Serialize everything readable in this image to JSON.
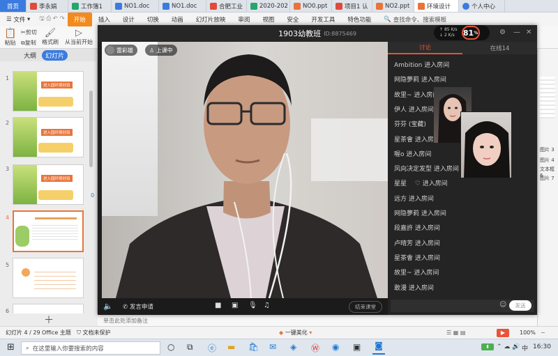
{
  "wps": {
    "tabs": [
      {
        "label": "首页",
        "color": "#3b7be0"
      },
      {
        "label": "李永娟",
        "color": "#e04a3b"
      },
      {
        "label": "工作簿1",
        "color": "#26a56c"
      },
      {
        "label": "NO1.doc",
        "color": "#3b7be0"
      },
      {
        "label": "NO1.doc",
        "color": "#3b7be0"
      },
      {
        "label": "合肥工业",
        "color": "#e04a3b"
      },
      {
        "label": "2020-202",
        "color": "#26a56c"
      },
      {
        "label": "NO0.ppt",
        "color": "#e8743a"
      },
      {
        "label": "项目1 认",
        "color": "#e04a3b"
      },
      {
        "label": "NO2.ppt",
        "color": "#e8743a"
      },
      {
        "label": "环境设计",
        "color": "#e8743a"
      },
      {
        "label": "个人中心",
        "color": "#3b7be0"
      }
    ],
    "file_menu": "文件",
    "menu": [
      "开始",
      "插入",
      "设计",
      "切换",
      "动画",
      "幻灯片放映",
      "审阅",
      "视图",
      "安全",
      "开发工具",
      "特色功能"
    ],
    "search_placeholder": "查找命令、搜索模板",
    "ribbon": {
      "cut": "剪切",
      "paste": "粘贴",
      "copy": "复制",
      "format_painter": "格式刷",
      "from_current": "从当前开始"
    },
    "panel_tabs": [
      "大纲",
      "幻灯片"
    ],
    "slide_numbers": [
      "1",
      "2",
      "3",
      "4",
      "5",
      "6"
    ],
    "slide_thumb_text": "进入园环境创设",
    "notes_placeholder": "单击此处添加备注",
    "status": {
      "slide_info": "幻灯片 4 / 29",
      "theme": "Office 主题",
      "protection": "文档未保护",
      "beautify": "一键美化",
      "zoom": "100%"
    },
    "right_strip": [
      "图片 3",
      "图片 4",
      "文本框 6",
      "图片 7"
    ],
    "right_zero": "0"
  },
  "classroom": {
    "title": "1903幼教班",
    "room_id": "ID:8875469",
    "net_up": "85 K/s",
    "net_down": "2 K/s",
    "cpu": "81",
    "cpu_unit": "%",
    "teacher_name": "雷彩雄",
    "teaching_badge": "上课中",
    "chat_tabs": [
      "讨论",
      "在线14"
    ],
    "messages": [
      "Ambition 进入房间",
      "网隐夢莉 进入房间",
      "故里~ 进入房间",
      "伊人 进入房间",
      "芬芬 (宝藏)",
      "星茶會 进入房间",
      "喔o 进入房间",
      "风向决定发型 进入房间",
      "星星　  ♡ 进入房间",
      "远方 进入房间",
      "网隐夢莉 进入房间",
      "段嘉許 进入房间",
      "卢晴芳 进入房间",
      "星茶會 进入房间",
      "故里~ 进入房间",
      "敢漫 进入房间"
    ],
    "speak_request": "发言申请",
    "end_class": "结束课堂",
    "send": "发送"
  },
  "taskbar": {
    "search_placeholder": "在这里输入你要搜索的内容",
    "time": "16:30",
    "lang": "中"
  }
}
